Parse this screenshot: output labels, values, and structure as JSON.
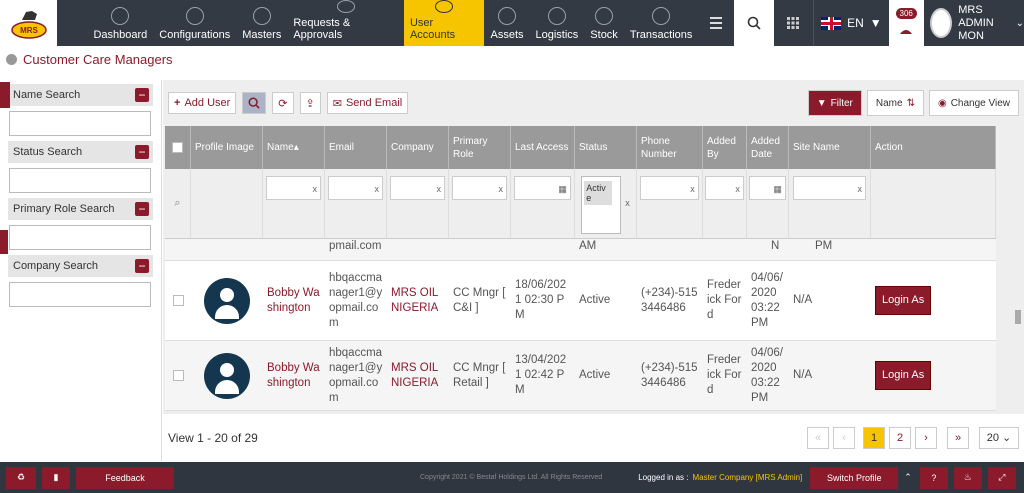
{
  "nav": [
    "Dashboard",
    "Configurations",
    "Masters",
    "Requests & Approvals",
    "User Accounts",
    "Assets",
    "Logistics",
    "Stock",
    "Transactions"
  ],
  "lang": "EN",
  "notif_count": "306",
  "user": {
    "name": "MRS ADMIN",
    "sub": "MON"
  },
  "logo": "MRS",
  "page_title": "Customer Care Managers",
  "sidebar": {
    "name": "Name Search",
    "status": "Status Search",
    "role": "Primary Role Search",
    "company": "Company Search"
  },
  "toolbar": {
    "add": "Add User",
    "send": "Send Email",
    "filter": "Filter",
    "sort": "Name",
    "view": "Change View"
  },
  "columns": [
    "Profile Image",
    "Name",
    "Email",
    "Company",
    "Primary Role",
    "Last Access",
    "Status",
    "Phone Number",
    "Added By",
    "Added Date",
    "Site Name",
    "Action"
  ],
  "status_filter": "Active",
  "partial": {
    "email": "pmail.com",
    "last": "AM",
    "added_by": "N",
    "added_date": "PM"
  },
  "rows": [
    {
      "name": "Bobby Washington",
      "email": "hbqaccmanager1@yopmail.com",
      "company": "MRS OIL NIGERIA",
      "role": "CC Mngr [ C&I ]",
      "last": "18/06/2021 02:30 PM",
      "status": "Active",
      "phone": "(+234)-5153446486",
      "by": "Frederick Ford",
      "date": "04/06/2020 03:22 PM",
      "site": "N/A",
      "action": "Login As"
    },
    {
      "name": "Bobby Washington",
      "email": "hbqaccmanager1@yopmail.com",
      "company": "MRS OIL NIGERIA",
      "role": "CC Mngr [ Retail ]",
      "last": "13/04/2021 02:42 PM",
      "status": "Active",
      "phone": "(+234)-5153446486",
      "by": "Frederick Ford",
      "date": "04/06/2020 03:22 PM",
      "site": "N/A",
      "action": "Login As"
    }
  ],
  "pager": {
    "info": "View 1 - 20 of 29",
    "pages": [
      "1",
      "2"
    ],
    "size": "20"
  },
  "footer": {
    "feedback": "Feedback",
    "copy": "Copyright 2021 © Bestaf Holdings Ltd. All Rights Reserved",
    "logged": "Logged in as :",
    "company": "Master Company [MRS Admin]",
    "switch": "Switch Profile"
  }
}
